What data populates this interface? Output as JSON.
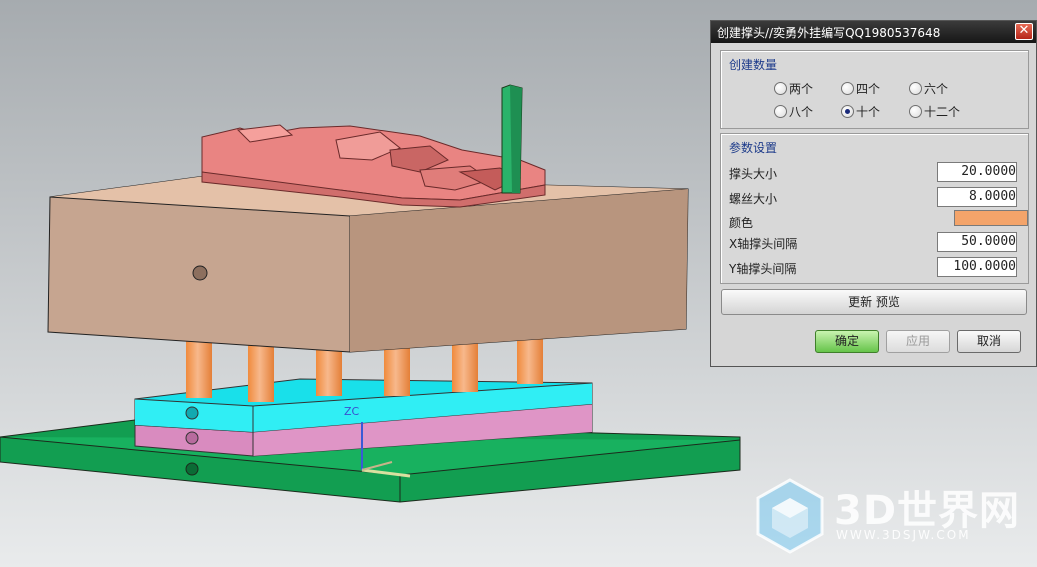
{
  "dialog": {
    "title": "创建撑头//奕勇外挂编写QQ1980537648",
    "close_icon": "✕",
    "quantity_group": {
      "title": "创建数量",
      "options": [
        {
          "label": "两个",
          "selected": false
        },
        {
          "label": "四个",
          "selected": false
        },
        {
          "label": "六个",
          "selected": false
        },
        {
          "label": "八个",
          "selected": false
        },
        {
          "label": "十个",
          "selected": true
        },
        {
          "label": "十二个",
          "selected": false
        }
      ]
    },
    "params_group": {
      "title": "参数设置",
      "head_size": {
        "label": "撑头大小",
        "value": "20.0000"
      },
      "screw_size": {
        "label": "螺丝大小",
        "value": "8.0000"
      },
      "color": {
        "label": "颜色",
        "value": "#f4a46a"
      },
      "x_spacing": {
        "label": "X轴撑头间隔",
        "value": "50.0000"
      },
      "y_spacing": {
        "label": "Y轴撑头间隔",
        "value": "100.0000"
      }
    },
    "update_preview_label": "更新  预览",
    "ok_label": "确定",
    "apply_label": "应用",
    "cancel_label": "取消"
  },
  "viewport": {
    "wcs_label": "ZC"
  },
  "watermark": {
    "brand": "3D世界网",
    "url": "WWW.3DSJW.COM"
  },
  "colors": {
    "background_top": "#a9aeb2",
    "background_bottom": "#e6e8ea",
    "mold_plate": "#c9a894",
    "core_part": "#e88a88",
    "support_pillar": "#f4a46a",
    "cyan_plate": "#1fe8ef",
    "pink_plate": "#d98bbf",
    "base_plate": "#11a255",
    "accent_green": "#2ab36a"
  }
}
